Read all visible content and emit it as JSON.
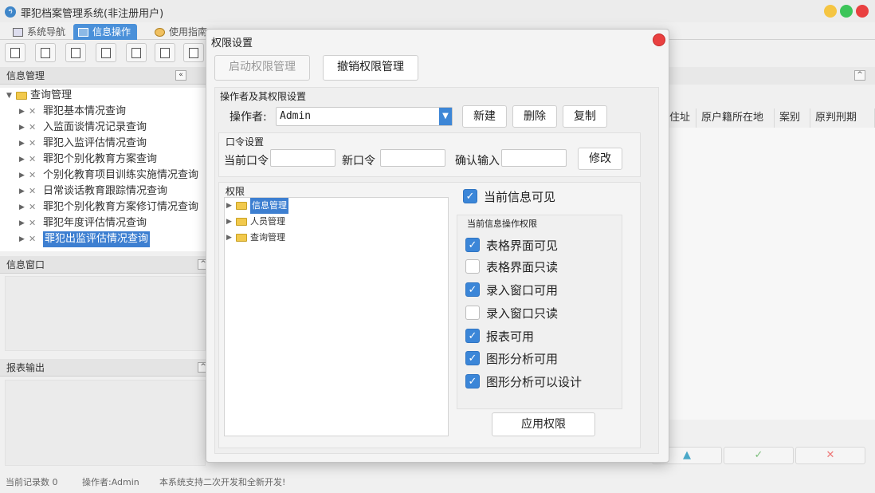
{
  "app": {
    "title": "罪犯档案管理系统(非注册用户)"
  },
  "tabs": [
    {
      "label": "系统导航"
    },
    {
      "label": "信息操作"
    },
    {
      "label": "使用指南"
    }
  ],
  "left": {
    "info_header": "信息管理",
    "tree_root": "查询管理",
    "tree_items": [
      "罪犯基本情况查询",
      "入监面谈情况记录查询",
      "罪犯入监评估情况查询",
      "罪犯个别化教育方案查询",
      "个别化教育项目训练实施情况查询",
      "日常谈话教育跟踪情况查询",
      "罪犯个别化教育方案修订情况查询",
      "罪犯年度评估情况查询",
      "罪犯出监评估情况查询"
    ],
    "info_window_header": "信息窗口",
    "report_header": "报表输出"
  },
  "right": {
    "columns": [
      "住址",
      "原户籍所在地",
      "案别",
      "原判刑期"
    ]
  },
  "status": {
    "records": "当前记录数 0",
    "operator": "操作者:Admin",
    "message": "本系统支持二次开发和全新开发!"
  },
  "dialog": {
    "title": "权限设置",
    "enable_btn": "启动权限管理",
    "revoke_btn": "撤销权限管理",
    "operators_group": "操作者及其权限设置",
    "operator_label": "操作者:",
    "operator_value": "Admin",
    "new_btn": "新建",
    "delete_btn": "删除",
    "copy_btn": "复制",
    "password_group": "口令设置",
    "current_pwd_label": "当前口令",
    "new_pwd_label": "新口令",
    "confirm_label": "确认输入",
    "modify_btn": "修改",
    "perm_group": "权限",
    "perm_tree": [
      "信息管理",
      "人员管理",
      "查询管理"
    ],
    "current_visible": "当前信息可见",
    "ops_group": "当前信息操作权限",
    "ops": [
      {
        "label": "表格界面可见",
        "checked": true
      },
      {
        "label": "表格界面只读",
        "checked": false
      },
      {
        "label": "录入窗口可用",
        "checked": true
      },
      {
        "label": "录入窗口只读",
        "checked": false
      },
      {
        "label": "报表可用",
        "checked": true
      },
      {
        "label": "图形分析可用",
        "checked": true
      },
      {
        "label": "图形分析可以设计",
        "checked": true
      }
    ],
    "apply_btn": "应用权限"
  },
  "colors": {
    "accent": "#3b86d8",
    "close": "#e94040",
    "min": "#f5c542",
    "max": "#3cc55a"
  }
}
